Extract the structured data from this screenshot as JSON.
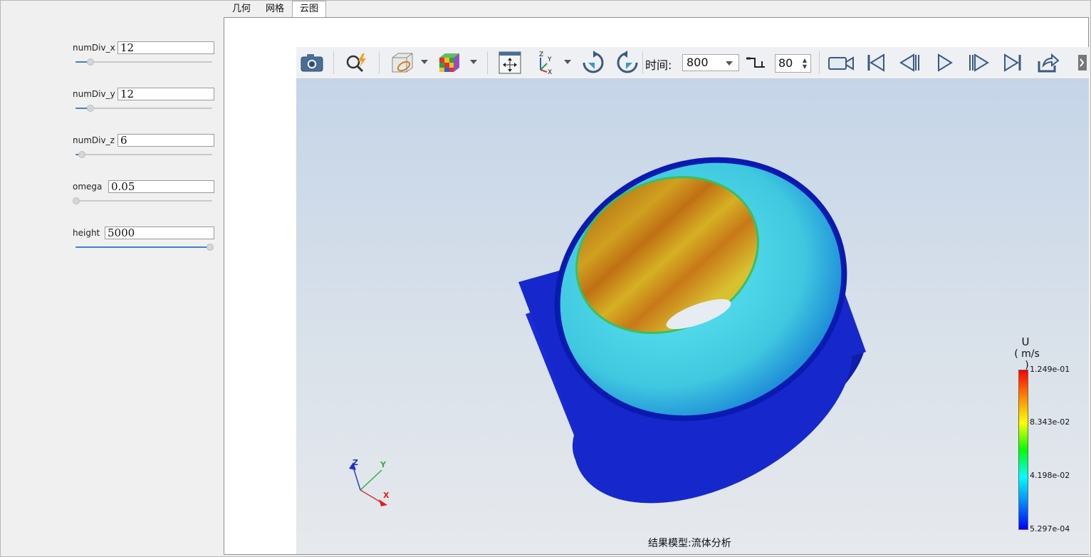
{
  "params": {
    "numDiv_x": {
      "label": "numDiv_x",
      "value": "12",
      "level": 0.1
    },
    "numDiv_y": {
      "label": "numDiv_y",
      "value": "12",
      "level": 0.1
    },
    "numDiv_z": {
      "label": "numDiv_z",
      "value": "6",
      "level": 0.05
    },
    "omega": {
      "label": "omega",
      "value": "0.05",
      "level": 0.0
    },
    "height": {
      "label": "height",
      "value": "5000",
      "level": 1.0
    }
  },
  "tabs": [
    {
      "label": "几何",
      "active": false
    },
    {
      "label": "网格",
      "active": false
    },
    {
      "label": "云图",
      "active": true
    }
  ],
  "toolbar": {
    "time_label": "时间:",
    "time_value": "800",
    "step_value": "80",
    "icons": [
      "camera-icon",
      "zoom-fit-icon",
      "clip-plane-icon",
      "color-cube-icon",
      "pan-icon",
      "axes-icon",
      "rotate-cw-icon",
      "rotate-ccw-icon",
      "record-icon",
      "first-frame-icon",
      "prev-frame-icon",
      "play-icon",
      "next-frame-icon",
      "last-frame-icon",
      "export-icon"
    ]
  },
  "viewport": {
    "caption": "结果模型:流体分析",
    "triad": {
      "z": "Z",
      "y": "Y",
      "x": "X"
    }
  },
  "legend": {
    "variable": "U",
    "unit": "( m/s )",
    "max": "1.249e-01",
    "tick2": "8.343e-02",
    "tick3": "4.198e-02",
    "min": "5.297e-04",
    "colors": [
      "#ff0000",
      "#ffff00",
      "#00ff00",
      "#00ffff",
      "#0000ff"
    ]
  }
}
